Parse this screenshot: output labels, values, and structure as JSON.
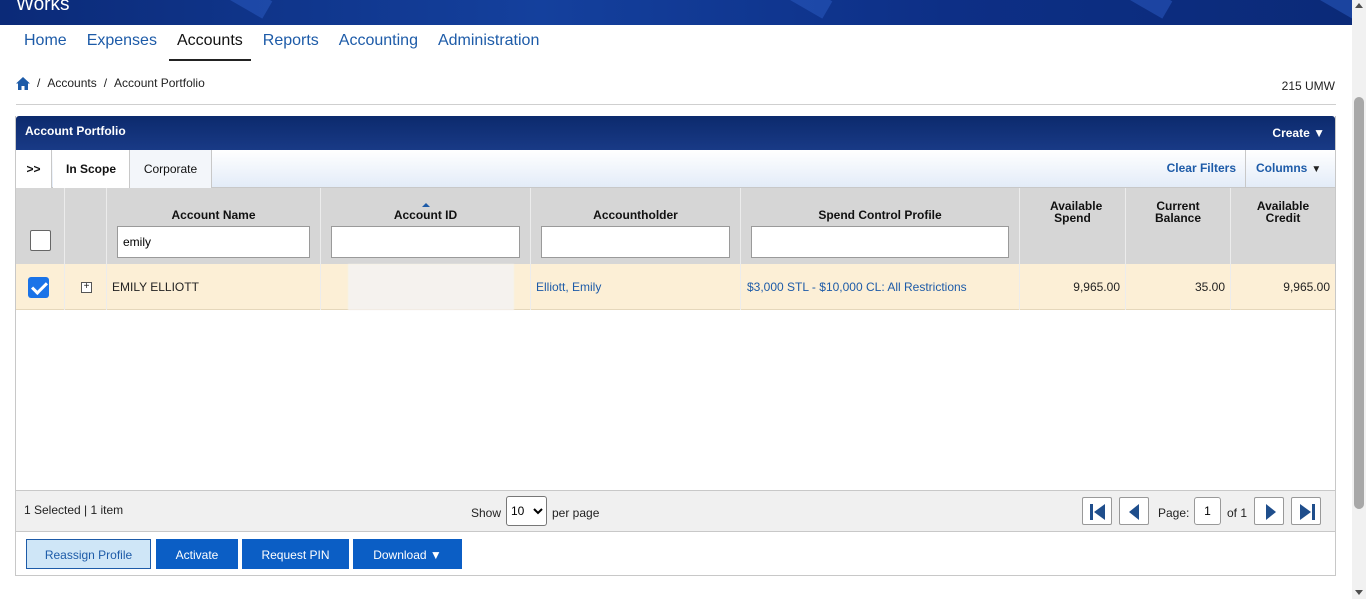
{
  "app": {
    "brand": "Works"
  },
  "nav": {
    "items": [
      {
        "label": "Home"
      },
      {
        "label": "Expenses"
      },
      {
        "label": "Accounts",
        "active": true
      },
      {
        "label": "Reports"
      },
      {
        "label": "Accounting"
      },
      {
        "label": "Administration"
      }
    ]
  },
  "breadcrumb": {
    "home_icon": "home-icon",
    "items": [
      "Accounts",
      "Account Portfolio"
    ],
    "sep": "/"
  },
  "org_code": "215 UMW",
  "panel": {
    "title": "Account Portfolio",
    "create_label": "Create ▼",
    "tabs": [
      ">>",
      "In Scope",
      "Corporate"
    ],
    "clear_filters": "Clear Filters",
    "columns_label": "Columns",
    "columns_caret": "▼"
  },
  "table": {
    "headers": {
      "account_name": "Account Name",
      "account_id": "Account ID",
      "accountholder": "Accountholder",
      "spend_control_profile": "Spend Control Profile",
      "available_spend": "Available Spend",
      "current_balance": "Current Balance",
      "available_credit": "Available Credit"
    },
    "filters": {
      "account_name": "emily",
      "account_id": "",
      "accountholder": "",
      "spend_control_profile": ""
    },
    "rows": [
      {
        "selected": true,
        "expander": "+",
        "account_name": "EMILY ELLIOTT",
        "account_id": "",
        "accountholder": "Elliott, Emily",
        "spend_control_profile": "$3,000 STL - $10,000 CL: All Restrictions",
        "available_spend": "9,965.00",
        "current_balance": "35.00",
        "available_credit": "9,965.00"
      }
    ]
  },
  "pager": {
    "count_text": "1 Selected | 1 item",
    "show_label": "Show",
    "per_page_value": "10",
    "per_page_label": "per page",
    "page_label": "Page:",
    "page_value": "1",
    "of_label": "of 1"
  },
  "actions": {
    "reassign": "Reassign Profile",
    "activate": "Activate",
    "request_pin": "Request PIN",
    "download": "Download ▼"
  },
  "colors": {
    "accent": "#1d5ba8",
    "header_dark": "#0c2a6d",
    "selected_row": "#fcefd6",
    "button_blue": "#0b5ec5"
  }
}
